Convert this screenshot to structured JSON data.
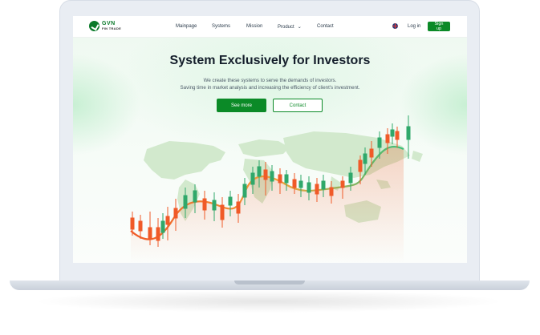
{
  "logo": {
    "name": "GVN",
    "tagline": "FIN TRADE"
  },
  "nav": {
    "items": [
      "Mainpage",
      "Systems",
      "Mission",
      "Product",
      "Contact"
    ],
    "login": "Log in",
    "signup": "Sign up"
  },
  "hero": {
    "title": "System Exclusively for Investors",
    "subtitle_line1": "We create these systems to serve the demands of investors.",
    "subtitle_line2": "Saving time in market analysis and increasing the efficiency of client's investment.",
    "primary_button": "See more",
    "secondary_button": "Contact"
  },
  "colors": {
    "brand": "#0b8a27",
    "candle_up": "#2fa86a",
    "candle_down": "#f05a28",
    "map": "#cfe8c9"
  },
  "icons": [
    "logo-mark",
    "chevron-down-icon",
    "uk-flag-icon"
  ]
}
